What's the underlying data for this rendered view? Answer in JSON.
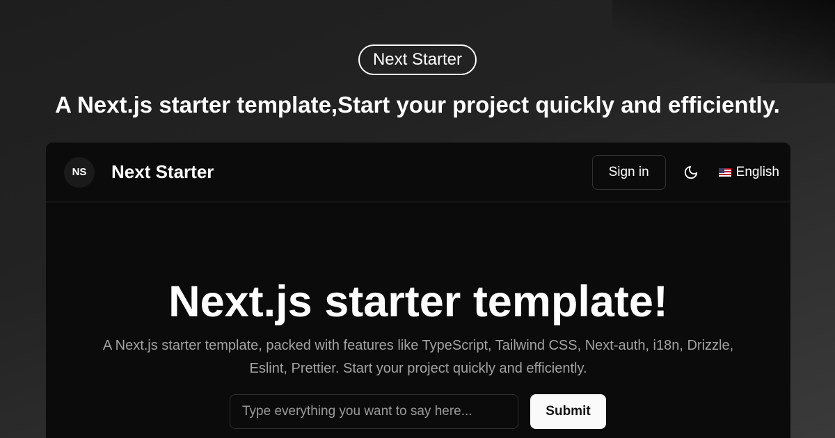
{
  "badge": {
    "label": "Next Starter"
  },
  "headline": {
    "text": "A Next.js starter template,Start your project quickly and efficiently."
  },
  "navbar": {
    "logo_text": "NS",
    "brand": "Next Starter",
    "signin_label": "Sign in",
    "theme_icon": "moon-icon",
    "language": {
      "flag_icon": "us-flag-icon",
      "label": "English"
    }
  },
  "hero": {
    "title": "Next.js starter template!",
    "description": "A Next.js starter template, packed with features like TypeScript, Tailwind CSS, Next-auth, i18n, Drizzle, Eslint, Prettier. Start your project quickly and efficiently."
  },
  "form": {
    "placeholder": "Type everything you want to say here...",
    "value": "",
    "submit_label": "Submit"
  },
  "colors": {
    "window_bg": "#0b0b0b",
    "text_primary": "#ffffff",
    "text_muted": "#a3a3a3",
    "submit_bg": "#fafafa"
  }
}
